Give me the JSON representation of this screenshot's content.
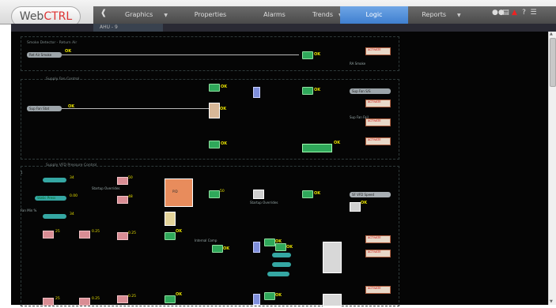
{
  "app": {
    "logo_web": "Web",
    "logo_ctrl": "CTRL"
  },
  "nav": {
    "back_icon": "back-arrow-icon",
    "items": [
      {
        "label": "Graphics",
        "has_menu": true
      },
      {
        "label": "Properties",
        "has_menu": false
      },
      {
        "label": "Alarms",
        "has_menu": false
      },
      {
        "label": "Trends",
        "has_menu": true
      },
      {
        "label": "Logic",
        "has_menu": false,
        "active": true
      },
      {
        "label": "Reports",
        "has_menu": true
      }
    ],
    "caret": "▼",
    "tool_icons": [
      "binoculars-icon",
      "print-icon",
      "alarm-warning-icon",
      "help-icon",
      "menu-icon"
    ]
  },
  "location": {
    "crumb": "AHU - 9"
  },
  "colors": {
    "accent": "#3f7fcf",
    "canvas": "#050505",
    "block_green": "#2fa85a",
    "status_ok": "#e7e000"
  },
  "logic": {
    "sections": [
      {
        "title": "Smoke Detector - Return Air"
      },
      {
        "title": "Supply Fan Control"
      },
      {
        "title": "Supply VFD Pressure Control"
      }
    ],
    "inputs": {
      "smoke": "Ret Air Smoke",
      "fan_stat": "Sup Fan Stat",
      "static_press": "Static Press",
      "static_sp": "1",
      "min_pct": "Fan Min %",
      "min_value": "0"
    },
    "outputs": {
      "smoke_label": "RA Smoke",
      "sup_fan_ss": "Sup Fan S/S",
      "sup_fan_fail": "Sup Fan Fail",
      "vfd_speed": "SF VFD Speed"
    },
    "block_labels": {
      "pid": "PID",
      "ok": "OK",
      "alarm": "ACTIVATE",
      "startup": "Startup Overrides",
      "internal": "Internal Comp"
    },
    "values": [
      "25",
      "0.25",
      "0.25",
      "34",
      "50",
      "48",
      "0.00"
    ]
  }
}
